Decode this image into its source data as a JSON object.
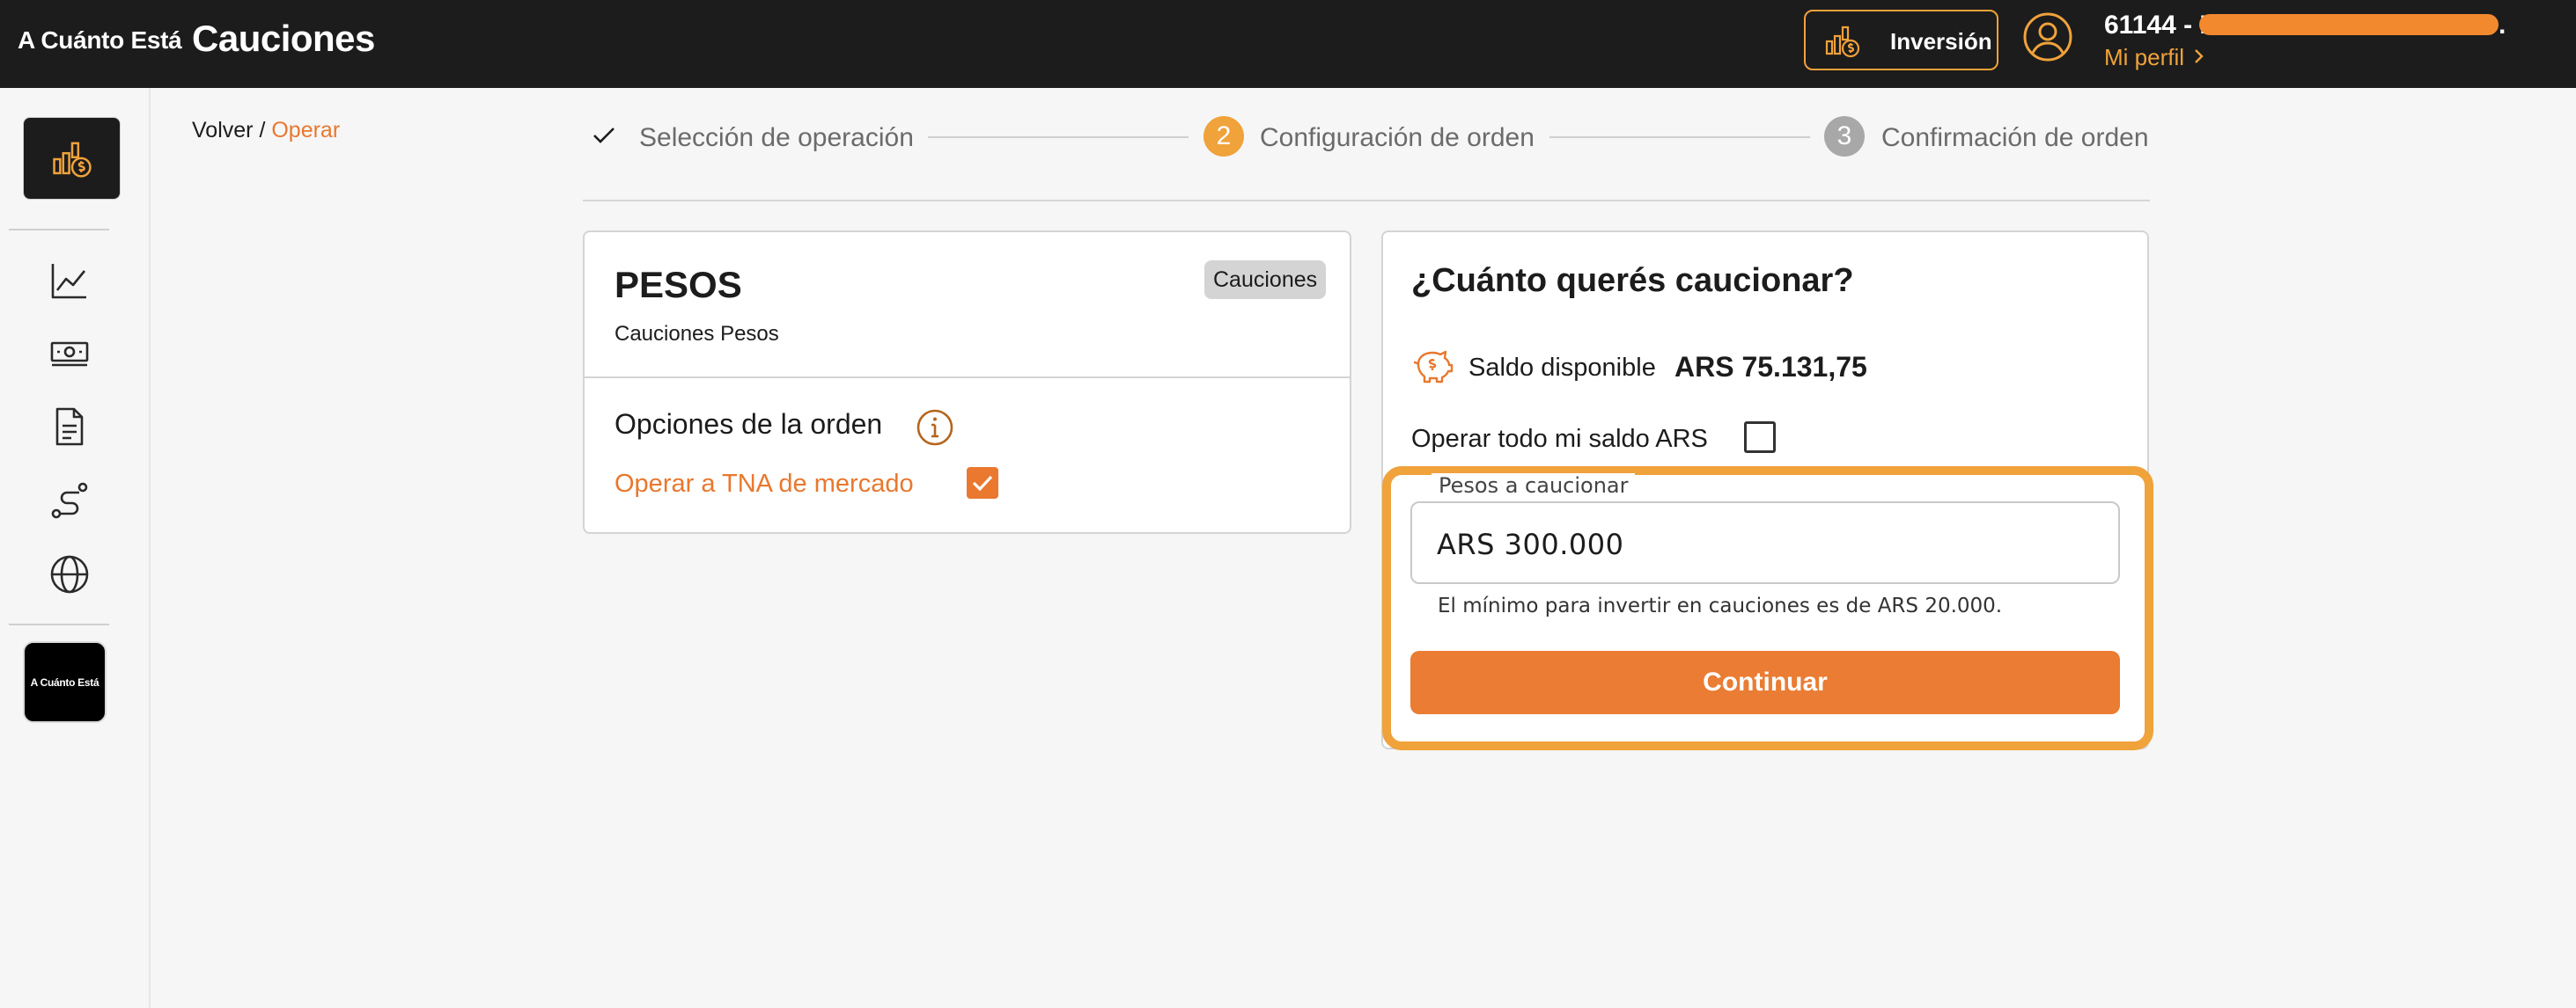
{
  "header": {
    "brand": "A Cuánto Está",
    "title": "Cauciones",
    "invest_button": "Inversión",
    "user_id": "61144 - I",
    "user_suffix": ".",
    "profile_link": "Mi perfil"
  },
  "sidebar": {
    "logo_text": "A Cuánto Está",
    "items": [
      "chart-line-icon",
      "banknote-icon",
      "document-icon",
      "route-icon",
      "globe-icon"
    ]
  },
  "breadcrumb": {
    "back": "Volver",
    "separator": "/",
    "current": "Operar"
  },
  "stepper": {
    "steps": [
      {
        "number": "",
        "label": "Selección de operación",
        "state": "done"
      },
      {
        "number": "2",
        "label": "Configuración de orden",
        "state": "active"
      },
      {
        "number": "3",
        "label": "Confirmación de orden",
        "state": "pending"
      }
    ],
    "colors": {
      "active": "#f0a23b",
      "pending": "#a8a8a8"
    }
  },
  "asset": {
    "name": "PESOS",
    "subtitle": "Cauciones Pesos",
    "badge": "Cauciones",
    "options_title": "Opciones de la orden",
    "tna_label": "Operar a TNA de mercado",
    "tna_checked": true
  },
  "order": {
    "title": "¿Cuánto querés caucionar?",
    "saldo_label": "Saldo disponible",
    "saldo_value": "ARS 75.131,75",
    "all_label": "Operar todo mi saldo ARS",
    "all_checked": false,
    "field_label": "Pesos a caucionar",
    "field_value": "ARS 300.000",
    "hint": "El mínimo para invertir en cauciones es de ARS 20.000.",
    "continue": "Continuar"
  },
  "colors": {
    "accent": "#ea7c33",
    "highlight": "#f0a23b",
    "header_bg": "#1c1c1c"
  }
}
